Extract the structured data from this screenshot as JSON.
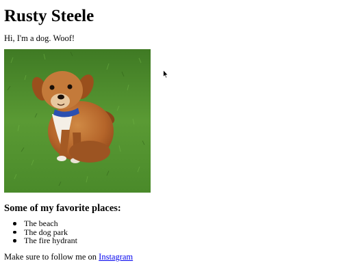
{
  "page": {
    "title": "Rusty Steele",
    "intro": "Hi, I'm a dog. Woof!",
    "photo": {
      "subject": "small brown and white dog sitting on green grass with a blue collar"
    },
    "favorites_heading": "Some of my favorite places:",
    "favorites": [
      "The beach",
      "The dog park",
      "The fire hydrant"
    ],
    "follow_text": "Make sure to follow me on ",
    "follow_link": "Instagram"
  },
  "colors": {
    "link": "#0000ee",
    "text": "#000000",
    "background": "#ffffff",
    "grass": "#4f8a2c",
    "dog_fur": "#b5652a",
    "collar": "#2a4fb0"
  },
  "icons": {
    "cursor": "mouse-pointer-icon"
  }
}
